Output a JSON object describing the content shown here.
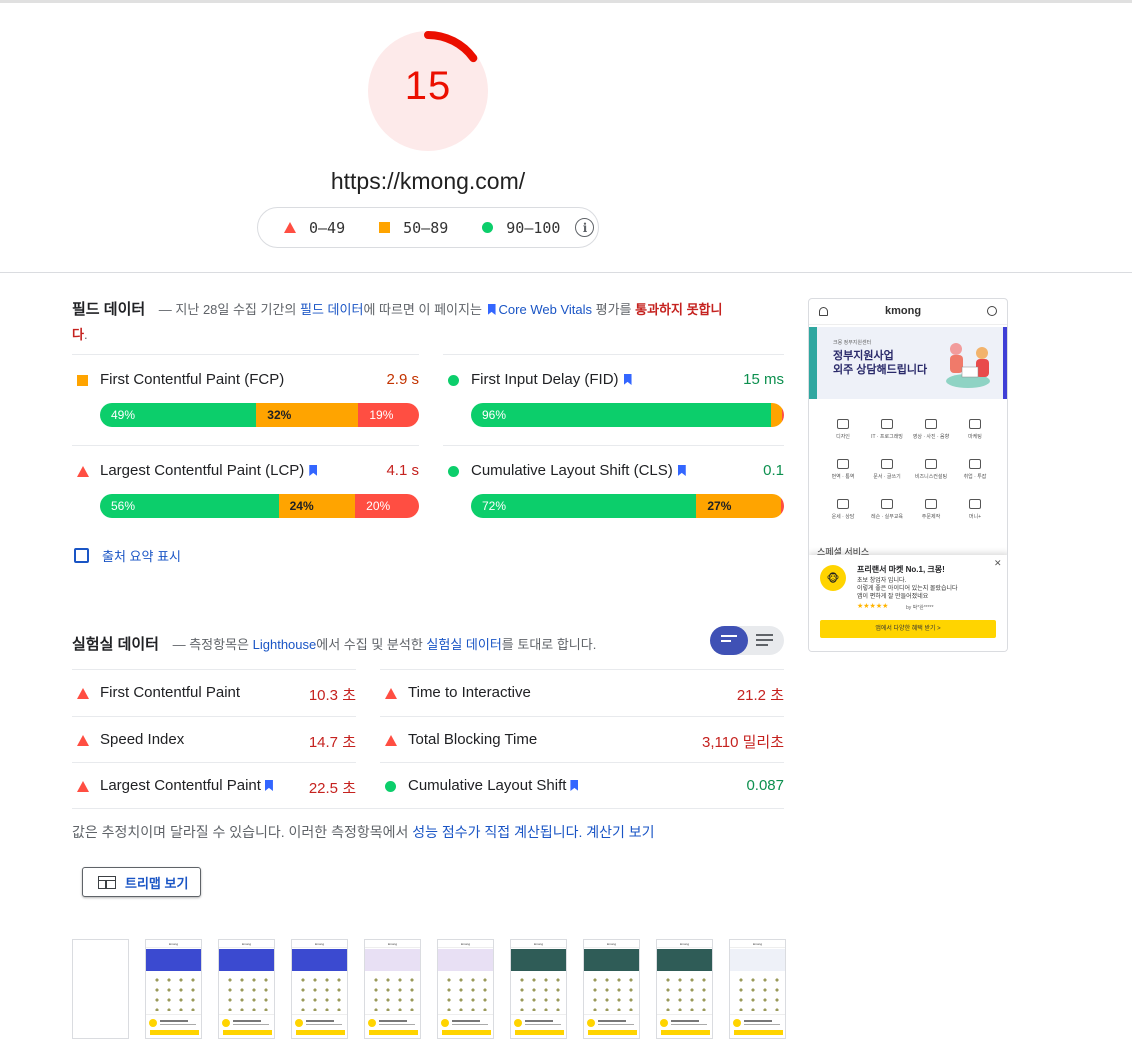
{
  "score": {
    "value": "15",
    "fraction": 0.15,
    "color": "#eb0f00",
    "bg": "#fdeaea"
  },
  "url": "https://kmong.com/",
  "legend": {
    "fail": "0–49",
    "average": "50–89",
    "pass": "90–100",
    "info_icon": "info-icon"
  },
  "field": {
    "title": "필드 데이터",
    "desc_prefix": "— 지난 28일 수집 기간의",
    "desc_link": "필드 데이터",
    "desc_mid": "에 따르면 이 페이지는",
    "cwv": "Core Web Vitals",
    "desc_mid2": "평가를",
    "fail_text": "통과하지 못합니다",
    "desc_end": ".",
    "metrics": [
      {
        "name": "First Contentful Paint (FCP)",
        "value": "2.9 s",
        "status": "average",
        "cwv": false,
        "dist": [
          "49%",
          "32%",
          "19%"
        ],
        "fracs": [
          0.49,
          0.32,
          0.19
        ]
      },
      {
        "name": "First Input Delay (FID)",
        "value": "15 ms",
        "status": "pass",
        "cwv": true,
        "dist": [
          "96%",
          "3%",
          "2%"
        ],
        "fracs": [
          0.96,
          0.03,
          0.02
        ]
      },
      {
        "name": "Largest Contentful Paint (LCP)",
        "value": "4.1 s",
        "status": "fail",
        "cwv": true,
        "dist": [
          "56%",
          "24%",
          "20%"
        ],
        "fracs": [
          0.56,
          0.24,
          0.2
        ]
      },
      {
        "name": "Cumulative Layout Shift (CLS)",
        "value": "0.1",
        "status": "pass",
        "cwv": true,
        "dist": [
          "72%",
          "27%",
          "1%"
        ],
        "fracs": [
          0.72,
          0.27,
          0.01
        ]
      }
    ],
    "origin_label": "출처 요약 표시"
  },
  "lab": {
    "title": "실험실 데이터",
    "desc_prefix": "— 측정항목은",
    "desc_link1": "Lighthouse",
    "desc_mid": "에서 수집 및 분석한",
    "desc_link2": "실험실 데이터",
    "desc_end": "를 토대로 합니다.",
    "metrics": [
      {
        "name": "First Contentful Paint",
        "value": "10.3 초",
        "status": "fail",
        "cwv": false
      },
      {
        "name": "Time to Interactive",
        "value": "21.2 초",
        "status": "fail",
        "cwv": false
      },
      {
        "name": "Speed Index",
        "value": "14.7 초",
        "status": "fail",
        "cwv": false
      },
      {
        "name": "Total Blocking Time",
        "value": "3,110 밀리초",
        "status": "fail",
        "cwv": false
      },
      {
        "name": "Largest Contentful Paint",
        "value": "22.5 초",
        "status": "fail",
        "cwv": true
      },
      {
        "name": "Cumulative Layout Shift",
        "value": "0.087",
        "status": "pass",
        "cwv": true
      }
    ],
    "note_prefix": "값은 추정치이며 달라질 수 있습니다. 이러한 측정항목에서",
    "note_link1": "성능 점수가 직접 계산됩니다.",
    "note_link2": "계산기 보기",
    "treemap_label": "트리맵 보기"
  },
  "preview": {
    "logo": "kmong",
    "banner_small": "크몽 정부지원센터",
    "banner_line1": "정부지원사업",
    "banner_line2": "외주 상담해드립니다",
    "categories": [
      "디자인",
      "IT · 프로그래밍",
      "영상 · 사진 · 음향",
      "마케팅",
      "번역 · 통역",
      "문서 · 글쓰기",
      "비즈니스컨설팅",
      "취업 · 투잡",
      "운세 · 상담",
      "레슨 · 실무교육",
      "주문제작",
      "머니+"
    ],
    "section_title": "스페셜 서비스",
    "popup_title": "프리랜서 마켓 No.1, 크몽!",
    "popup_line1": "초보 창업자 입니다.",
    "popup_line2": "이렇게 좋은 아이디어 있는지 몰랐습니다",
    "popup_line3": "앱이 편하게 잘 만들어졌네요",
    "popup_stars": "★★★★★",
    "popup_by": "by 박*완*****",
    "popup_btn": "앱에서 다양한 혜택 받기 >",
    "popup_close": "✕"
  },
  "filmstrip": {
    "frames": 10,
    "logo": "kmong"
  },
  "colors": {
    "fail": "#ff4e42",
    "average": "#ffa400",
    "pass": "#0cce6b",
    "link": "#1a55c5"
  }
}
